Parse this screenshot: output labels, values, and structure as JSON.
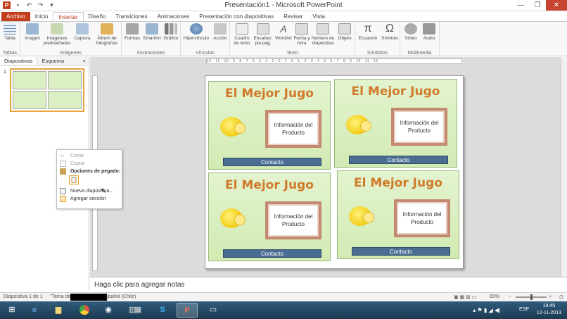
{
  "window": {
    "title": "Presentación1 - Microsoft PowerPoint",
    "qat_icons": [
      "powerpoint-logo",
      "save-icon",
      "undo-icon",
      "redo-icon",
      "customize-icon"
    ],
    "logo_letter": "P"
  },
  "tabs": [
    "Archivo",
    "Inicio",
    "Insertar",
    "Diseño",
    "Transiciones",
    "Animaciones",
    "Presentación con diapositivas",
    "Revisar",
    "Vista"
  ],
  "active_tab": "Insertar",
  "ribbon": {
    "groups": [
      {
        "name": "Tablas",
        "buttons": [
          "Tabla"
        ]
      },
      {
        "name": "Imágenes",
        "buttons": [
          "Imagen",
          "Imágenes prediseñadas",
          "Captura",
          "Álbum de fotografías"
        ]
      },
      {
        "name": "Ilustraciones",
        "buttons": [
          "Formas",
          "SmartArt",
          "Gráfico"
        ]
      },
      {
        "name": "Vínculos",
        "buttons": [
          "Hipervínculo",
          "Acción"
        ]
      },
      {
        "name": "Texto",
        "buttons": [
          "Cuadro de texto",
          "Encabez. pie pág.",
          "WordArt",
          "Fecha y hora",
          "Número de diapositiva",
          "Objeto"
        ]
      },
      {
        "name": "Símbolos",
        "buttons": [
          "Ecuación",
          "Símbolo"
        ]
      },
      {
        "name": "Multimedia",
        "buttons": [
          "Vídeo",
          "Audio"
        ]
      }
    ]
  },
  "left_pane": {
    "tabs": [
      "Diapositivas",
      "Esquema"
    ],
    "close": "×",
    "slide_number": "1"
  },
  "context_menu": {
    "items": [
      {
        "label": "Cortar",
        "enabled": false
      },
      {
        "label": "Copiar",
        "enabled": false
      },
      {
        "label": "Opciones de pegado:",
        "header": true
      },
      {
        "label": "Nueva diapositiva...",
        "enabled": true
      },
      {
        "label": "Agregar sección",
        "enabled": true
      }
    ]
  },
  "ruler": {
    "labels": [
      "12",
      "11",
      "10",
      "9",
      "8",
      "7",
      "6",
      "5",
      "4",
      "3",
      "2",
      "1",
      "0",
      "1",
      "2",
      "3",
      "4",
      "5",
      "6",
      "7",
      "8",
      "9",
      "10",
      "11",
      "12"
    ]
  },
  "slide": {
    "cards": [
      {
        "title": "El Mejor Jugo",
        "info": "Información del Producto",
        "contact": "Contacto"
      },
      {
        "title": "El Mejor Jugo",
        "info": "Información del Producto",
        "contact": "Contacto"
      },
      {
        "title": "El Mejor Jugo",
        "info": "Información del Producto",
        "contact": "Contacto"
      },
      {
        "title": "El Mejor Jugo",
        "info": "Información del Producto",
        "contact": "Contacto"
      }
    ]
  },
  "notes_placeholder": "Haga clic para agregar notas",
  "statusbar": {
    "slide_info": "Diapositiva 1 de 1",
    "theme": "\"Tema de",
    "language": "spañol (Chile)",
    "zoom": "65%"
  },
  "taskbar": {
    "apps": [
      "windows-start",
      "internet-explorer",
      "file-explorer",
      "chrome",
      "media-app",
      "libraries",
      "calculator",
      "skype",
      "powerpoint",
      "desktop-window"
    ],
    "language": "ESP",
    "time": "19:45",
    "date": "12-11-2013"
  },
  "colors": {
    "accent": "#c43e1c",
    "card_title": "#d07a2a",
    "contact_bar": "#4a6e93",
    "card_bg": "#d2ebb4"
  }
}
